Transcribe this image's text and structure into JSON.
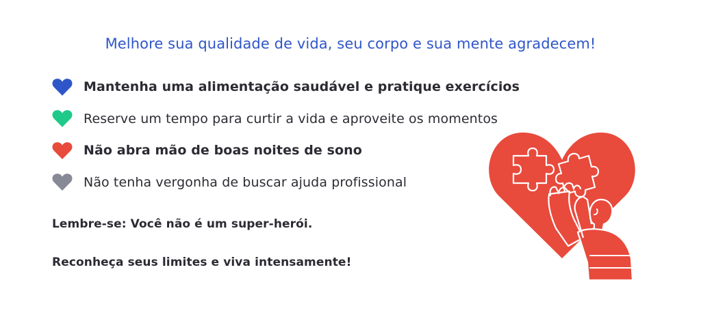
{
  "headline": "Melhore sua qualidade de vida, seu corpo e sua mente agradecem!",
  "colors": {
    "headline": "#2f56c9",
    "text": "#2b2b33",
    "heart_blue": "#2f56c9",
    "heart_green": "#1fc98a",
    "heart_red": "#e84a3c",
    "heart_gray": "#878a96",
    "illustration_red": "#e84a3c"
  },
  "tips": [
    {
      "icon": "heart-icon-blue",
      "text": "Mantenha uma alimentação saudável e pratique exercícios",
      "weight": "bold"
    },
    {
      "icon": "heart-icon-green",
      "text": "Reserve um tempo para curtir a vida e aproveite os momentos",
      "weight": "regular"
    },
    {
      "icon": "heart-icon-red",
      "text": "Não abra mão de boas noites de sono",
      "weight": "bold"
    },
    {
      "icon": "heart-icon-gray",
      "text": "Não tenha vergonha de buscar ajuda profissional",
      "weight": "regular"
    }
  ],
  "notes": {
    "line1": "Lembre-se: Você não é um super-herói.",
    "line2": "Reconheça seus limites e viva intensamente!"
  },
  "illustration": {
    "icon": "heart-puzzle-illustration"
  }
}
